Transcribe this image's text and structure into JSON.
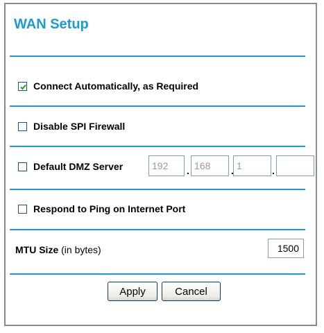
{
  "title": "WAN Setup",
  "options": {
    "connect_auto": {
      "label": "Connect Automatically, as Required",
      "checked": true
    },
    "disable_spi": {
      "label": "Disable SPI Firewall",
      "checked": false
    },
    "dmz": {
      "label": "Default DMZ Server",
      "checked": false,
      "ip": [
        "192",
        "168",
        "1",
        ""
      ]
    },
    "ping": {
      "label": "Respond to Ping on Internet Port",
      "checked": false
    }
  },
  "mtu": {
    "label_bold": "MTU Size",
    "label_suffix": " (in bytes)",
    "value": "1500"
  },
  "buttons": {
    "apply": "Apply",
    "cancel": "Cancel"
  },
  "colors": {
    "accent": "#1a9bd7"
  }
}
